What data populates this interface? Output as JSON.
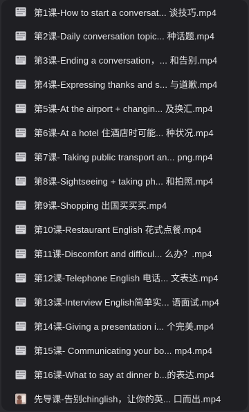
{
  "files": [
    {
      "name": "第1课-How to start a conversat... 谈技巧.mp4",
      "icon": "video-file-icon"
    },
    {
      "name": "第2课-Daily conversation topic... 种话题.mp4",
      "icon": "video-file-icon"
    },
    {
      "name": "第3课-Ending a conversation，... 和告别.mp4",
      "icon": "video-file-icon"
    },
    {
      "name": "第4课-Expressing thanks and s... 与道歉.mp4",
      "icon": "video-file-icon"
    },
    {
      "name": "第5课-At the airport + changin... 及换汇.mp4",
      "icon": "video-file-icon"
    },
    {
      "name": "第6课-At a hotel 住酒店时可能...   种状况.mp4",
      "icon": "video-file-icon"
    },
    {
      "name": "第7课- Taking public transport an... png.mp4",
      "icon": "video-file-icon"
    },
    {
      "name": "第8课-Sightseeing + taking ph... 和拍照.mp4",
      "icon": "video-file-icon"
    },
    {
      "name": "第9课-Shopping 出国买买买.mp4",
      "icon": "video-file-icon"
    },
    {
      "name": "第10课-Restaurant English 花式点餐.mp4",
      "icon": "video-file-icon"
    },
    {
      "name": "第11课-Discomfort and difficul... 么办？.mp4",
      "icon": "video-file-icon"
    },
    {
      "name": "第12课-Telephone English 电话... 文表达.mp4",
      "icon": "video-file-icon"
    },
    {
      "name": "第13课-Interview English简单实... 语面试.mp4",
      "icon": "video-file-icon"
    },
    {
      "name": "第14课-Giving a presentation i... 个完美.mp4",
      "icon": "video-file-icon"
    },
    {
      "name": "第15课- Communicating your bo... mp4.mp4",
      "icon": "video-file-icon"
    },
    {
      "name": "第16课-What to say at dinner b...的表达.mp4",
      "icon": "video-file-icon"
    },
    {
      "name": "先导课-告别chinglish，让你的英... 口而出.mp4",
      "icon": "video-thumbnail-icon"
    }
  ]
}
